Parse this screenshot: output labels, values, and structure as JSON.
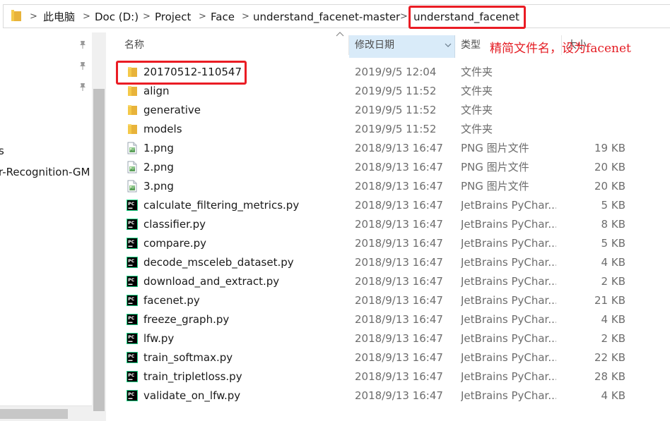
{
  "address_bar": {
    "crumbs": [
      "此电脑",
      "Doc (D:)",
      "Project",
      "Face",
      "understand_facenet-master",
      "understand_facenet"
    ]
  },
  "nav_pane": {
    "items": [
      "s",
      "r-Recognition-GM"
    ]
  },
  "columns": {
    "name": "名称",
    "date": "修改日期",
    "type": "类型",
    "size": "大小"
  },
  "annotation": "精简文件名，设为facenet",
  "files": [
    {
      "name": "20170512-110547",
      "date": "2019/9/5 12:04",
      "type": "文件夹",
      "size": "",
      "kind": "folder"
    },
    {
      "name": "align",
      "date": "2019/9/5 11:52",
      "type": "文件夹",
      "size": "",
      "kind": "folder"
    },
    {
      "name": "generative",
      "date": "2019/9/5 11:52",
      "type": "文件夹",
      "size": "",
      "kind": "folder"
    },
    {
      "name": "models",
      "date": "2019/9/5 11:52",
      "type": "文件夹",
      "size": "",
      "kind": "folder"
    },
    {
      "name": "1.png",
      "date": "2018/9/13 16:47",
      "type": "PNG 图片文件",
      "size": "19 KB",
      "kind": "png"
    },
    {
      "name": "2.png",
      "date": "2018/9/13 16:47",
      "type": "PNG 图片文件",
      "size": "20 KB",
      "kind": "png"
    },
    {
      "name": "3.png",
      "date": "2018/9/13 16:47",
      "type": "PNG 图片文件",
      "size": "20 KB",
      "kind": "png"
    },
    {
      "name": "calculate_filtering_metrics.py",
      "date": "2018/9/13 16:47",
      "type": "JetBrains PyChar...",
      "size": "5 KB",
      "kind": "py"
    },
    {
      "name": "classifier.py",
      "date": "2018/9/13 16:47",
      "type": "JetBrains PyChar...",
      "size": "8 KB",
      "kind": "py"
    },
    {
      "name": "compare.py",
      "date": "2018/9/13 16:47",
      "type": "JetBrains PyChar...",
      "size": "5 KB",
      "kind": "py"
    },
    {
      "name": "decode_msceleb_dataset.py",
      "date": "2018/9/13 16:47",
      "type": "JetBrains PyChar...",
      "size": "4 KB",
      "kind": "py"
    },
    {
      "name": "download_and_extract.py",
      "date": "2018/9/13 16:47",
      "type": "JetBrains PyChar...",
      "size": "2 KB",
      "kind": "py"
    },
    {
      "name": "facenet.py",
      "date": "2018/9/13 16:47",
      "type": "JetBrains PyChar...",
      "size": "21 KB",
      "kind": "py"
    },
    {
      "name": "freeze_graph.py",
      "date": "2018/9/13 16:47",
      "type": "JetBrains PyChar...",
      "size": "4 KB",
      "kind": "py"
    },
    {
      "name": "lfw.py",
      "date": "2018/9/13 16:47",
      "type": "JetBrains PyChar...",
      "size": "2 KB",
      "kind": "py"
    },
    {
      "name": "train_softmax.py",
      "date": "2018/9/13 16:47",
      "type": "JetBrains PyChar...",
      "size": "22 KB",
      "kind": "py"
    },
    {
      "name": "train_tripletloss.py",
      "date": "2018/9/13 16:47",
      "type": "JetBrains PyChar...",
      "size": "28 KB",
      "kind": "py"
    },
    {
      "name": "validate_on_lfw.py",
      "date": "2018/9/13 16:47",
      "type": "JetBrains PyChar...",
      "size": "4 KB",
      "kind": "py"
    }
  ],
  "colors": {
    "highlight": "#ea1c24",
    "annotation": "#e41c23",
    "sorted_column_bg": "#d9ebf9",
    "folder": "#f4c94a"
  },
  "icons": {
    "folder": "folder-icon",
    "png": "png-file-icon",
    "py": "pycharm-file-icon",
    "pin": "pin-icon"
  }
}
